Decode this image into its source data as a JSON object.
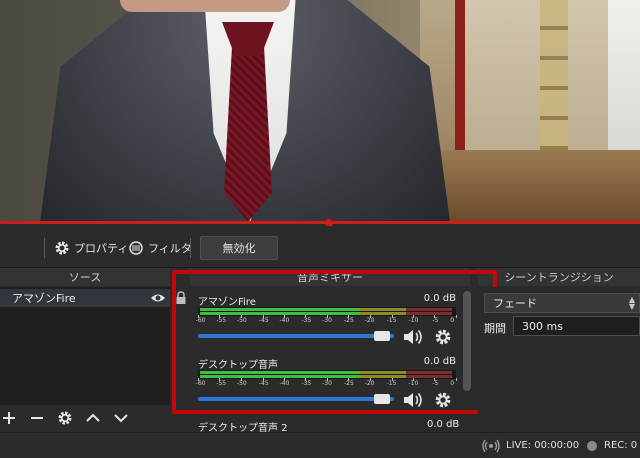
{
  "toolbar": {
    "properties": "プロパティ",
    "filters": "フィルタ",
    "disable": "無効化"
  },
  "docks": {
    "sources": "ソース",
    "mixer": "音声ミキサー",
    "transitions": "シーントランジション"
  },
  "sources": {
    "items": [
      {
        "name": "アマゾンFire"
      }
    ]
  },
  "mixer": {
    "ticks": [
      "-60",
      "-55",
      "-50",
      "-45",
      "-40",
      "-35",
      "-30",
      "-25",
      "-20",
      "-15",
      "-10",
      "-5",
      "0"
    ],
    "channels": [
      {
        "name": "アマゾンFire",
        "db": "0.0 dB"
      },
      {
        "name": "デスクトップ音声",
        "db": "0.0 dB"
      },
      {
        "name": "デスクトップ音声 2",
        "db": "0.0 dB"
      }
    ]
  },
  "transitions": {
    "selected": "フェード",
    "duration_label": "期間",
    "duration_value": "300 ms"
  },
  "status": {
    "live": "LIVE: 00:00:00",
    "rec": "REC: 0"
  },
  "colors": {
    "highlight": "#c3070b",
    "fader": "#2f76d6",
    "meter_green": "#3fbf3f",
    "meter_yellow": "#c8b93a",
    "meter_red": "#b83b3b"
  }
}
